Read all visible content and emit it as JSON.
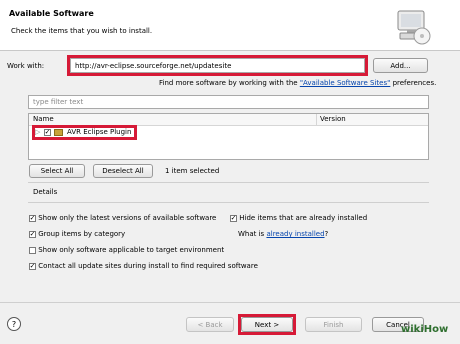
{
  "header": {
    "title": "Available Software",
    "subtitle": "Check the items that you wish to install."
  },
  "work_with": {
    "label": "Work with:",
    "value": "http://avr-eclipse.sourceforge.net/updatesite",
    "add_label": "Add..."
  },
  "more_software": {
    "prefix": "Find more software by working with the",
    "link": "\"Available Software Sites\"",
    "suffix": "preferences."
  },
  "filter": {
    "placeholder": "type filter text"
  },
  "table": {
    "columns": [
      "Name",
      "Version"
    ],
    "rows": [
      {
        "label": "AVR Eclipse Plugin",
        "checked": true
      }
    ]
  },
  "selection": {
    "select_all": "Select All",
    "deselect_all": "Deselect All",
    "status": "1 item selected"
  },
  "details": {
    "label": "Details"
  },
  "options": {
    "latest_versions": "Show only the latest versions of available software",
    "hide_installed": "Hide items that are already installed",
    "group_by_category": "Group items by category",
    "what_is": "What is",
    "already_installed": "already installed",
    "question_mark": "?",
    "target_env": "Show only software applicable to target environment",
    "contact_sites": "Contact all update sites during install to find required software"
  },
  "footer": {
    "help": "?",
    "back": "< Back",
    "next": "Next >",
    "finish": "Finish",
    "cancel": "Cancel"
  },
  "colors": {
    "highlight": "#d61a37",
    "link": "#0645ad",
    "dialog_bg": "#f0f0f0"
  }
}
